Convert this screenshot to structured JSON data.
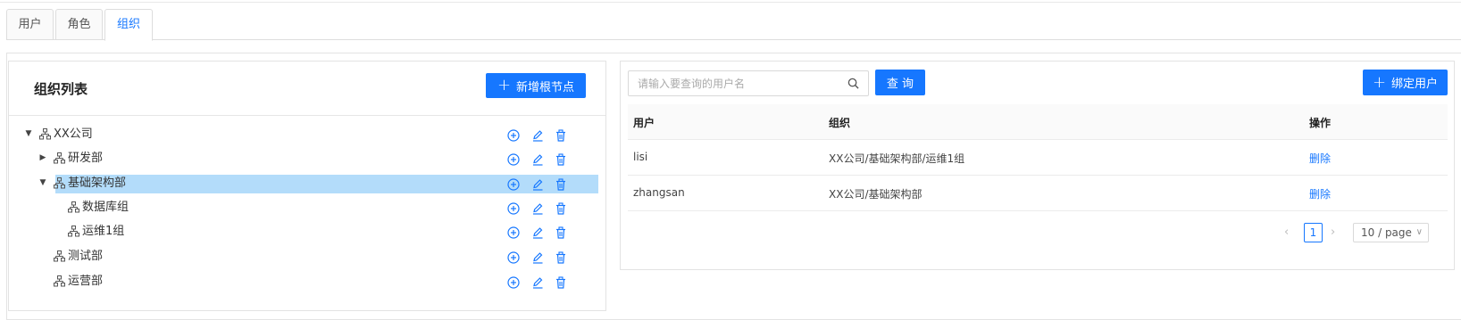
{
  "tabs": [
    {
      "label": "用户",
      "active": false
    },
    {
      "label": "角色",
      "active": false
    },
    {
      "label": "组织",
      "active": true
    }
  ],
  "left_panel": {
    "title": "组织列表",
    "add_root_button": "新增根节点",
    "tree": [
      {
        "label": "XX公司",
        "level": 0,
        "expanded": true,
        "has_children": true,
        "selected": false
      },
      {
        "label": "研发部",
        "level": 1,
        "expanded": false,
        "has_children": true,
        "selected": false
      },
      {
        "label": "基础架构部",
        "level": 1,
        "expanded": true,
        "has_children": true,
        "selected": true
      },
      {
        "label": "数据库组",
        "level": 2,
        "expanded": false,
        "has_children": false,
        "selected": false
      },
      {
        "label": "运维1组",
        "level": 2,
        "expanded": false,
        "has_children": false,
        "selected": false
      },
      {
        "label": "测试部",
        "level": 1,
        "expanded": false,
        "has_children": false,
        "selected": false
      },
      {
        "label": "运营部",
        "level": 1,
        "expanded": false,
        "has_children": false,
        "selected": false
      }
    ],
    "node_actions": [
      "add-circle-icon",
      "edit-icon",
      "delete-icon"
    ]
  },
  "right_panel": {
    "search": {
      "placeholder": "请输入要查询的用户名",
      "value": ""
    },
    "query_button": "查 询",
    "bind_user_button": "绑定用户",
    "table": {
      "columns": [
        "用户",
        "组织",
        "操作"
      ],
      "rows": [
        {
          "user": "lisi",
          "org": "XX公司/基础架构部/运维1组",
          "action": "删除"
        },
        {
          "user": "zhangsan",
          "org": "XX公司/基础架构部",
          "action": "删除"
        }
      ]
    },
    "pagination": {
      "current_page": "1",
      "page_size": "10 / page"
    }
  },
  "colors": {
    "primary": "#1677ff",
    "selected_row": "#b3dcfa"
  }
}
